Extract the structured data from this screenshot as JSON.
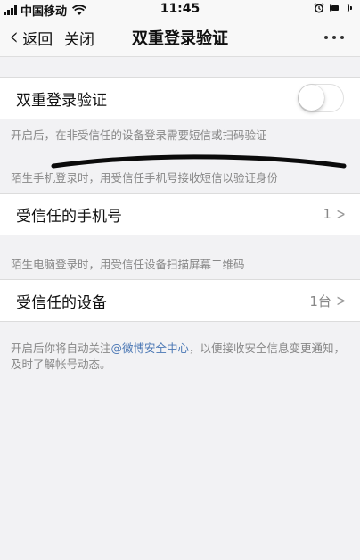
{
  "status_bar": {
    "carrier": "中国移动",
    "time": "11:45"
  },
  "nav": {
    "back_label": "返回",
    "close_label": "关闭",
    "title": "双重登录验证"
  },
  "two_factor": {
    "label": "双重登录验证",
    "enabled": false,
    "description": "开启后，在非受信任的设备登录需要短信或扫码验证"
  },
  "phone_section": {
    "note": "陌生手机登录时，用受信任手机号接收短信以验证身份",
    "label": "受信任的手机号",
    "value": "1",
    "chevron": ">"
  },
  "device_section": {
    "note": "陌生电脑登录时，用受信任设备扫描屏幕二维码",
    "label": "受信任的设备",
    "value": "1台",
    "chevron": ">"
  },
  "footer": {
    "text_before": "开启后你将自动关注",
    "link": "@微博安全中心",
    "text_after": "，以便接收安全信息变更通知，及时了解帐号动态。"
  },
  "colors": {
    "background": "#f2f2f4",
    "link": "#4a77b4",
    "muted_text": "#888888"
  }
}
